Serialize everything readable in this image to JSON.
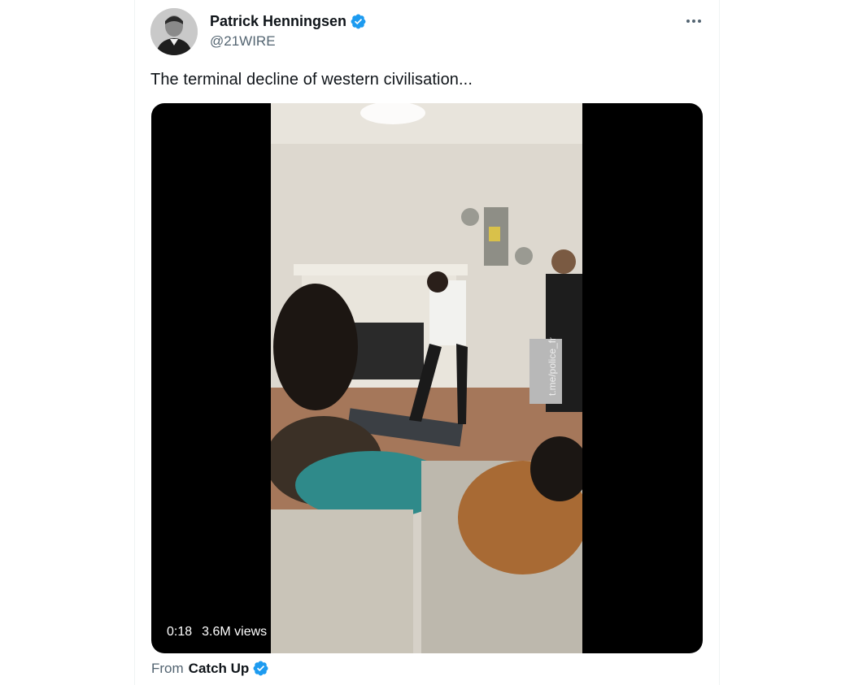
{
  "author": {
    "display_name": "Patrick Henningsen",
    "handle": "@21WIRE",
    "verified": true,
    "avatar_icon": "user-avatar"
  },
  "tweet": {
    "text": "The terminal decline of western civilisation..."
  },
  "video": {
    "duration": "0:18",
    "views": "3.6M views",
    "watermark": "t.me/police_fr"
  },
  "source": {
    "prefix": "From",
    "name": "Catch Up",
    "verified": true
  },
  "colors": {
    "verified_blue": "#1d9bf0",
    "text_primary": "#0f1419",
    "text_secondary": "#536471",
    "border": "#eff3f4"
  },
  "icons": [
    "verified-badge-icon",
    "more-options-icon"
  ]
}
